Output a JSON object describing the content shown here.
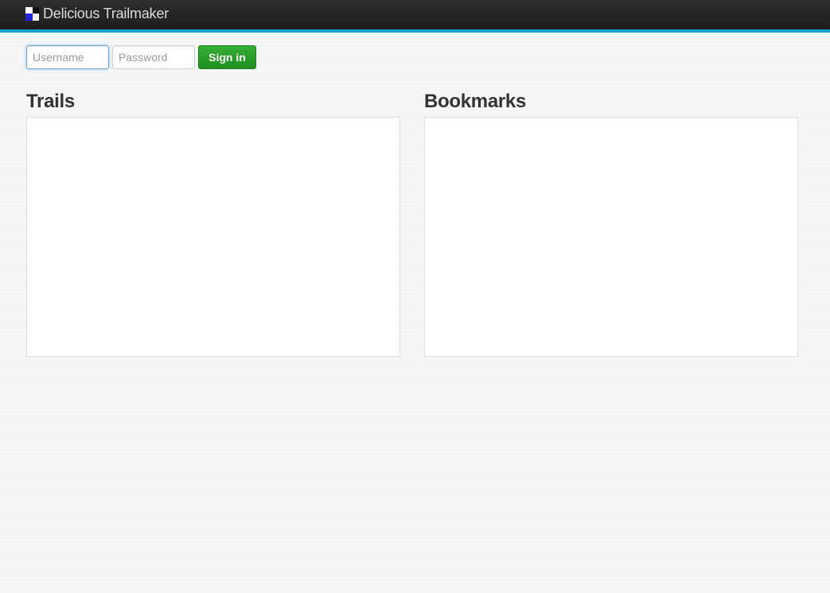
{
  "header": {
    "brand": "Delicious Trailmaker",
    "logo_colors": [
      "#ffffff",
      "#111111",
      "#2222dd",
      "#ffffff"
    ],
    "accent_color": "#1a9fd1"
  },
  "signin": {
    "username_placeholder": "Username",
    "username_value": "",
    "password_placeholder": "Password",
    "password_value": "",
    "button_label": "Sign in",
    "button_color": "#2a9c2a"
  },
  "trails": {
    "title": "Trails",
    "items": []
  },
  "bookmarks": {
    "title": "Bookmarks",
    "items": []
  }
}
